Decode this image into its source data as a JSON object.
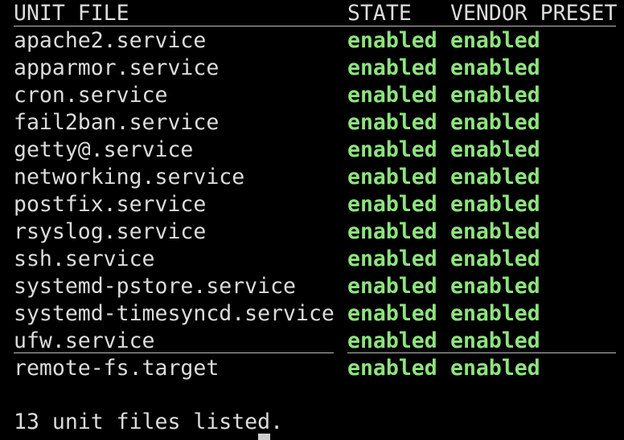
{
  "header": {
    "unit_file": "UNIT FILE",
    "state": "STATE",
    "vendor_preset": "VENDOR PRESET"
  },
  "rows": [
    {
      "unit": "apache2.service",
      "state": "enabled",
      "vendor": "enabled"
    },
    {
      "unit": "apparmor.service",
      "state": "enabled",
      "vendor": "enabled"
    },
    {
      "unit": "cron.service",
      "state": "enabled",
      "vendor": "enabled"
    },
    {
      "unit": "fail2ban.service",
      "state": "enabled",
      "vendor": "enabled"
    },
    {
      "unit": "getty@.service",
      "state": "enabled",
      "vendor": "enabled"
    },
    {
      "unit": "networking.service",
      "state": "enabled",
      "vendor": "enabled"
    },
    {
      "unit": "postfix.service",
      "state": "enabled",
      "vendor": "enabled"
    },
    {
      "unit": "rsyslog.service",
      "state": "enabled",
      "vendor": "enabled"
    },
    {
      "unit": "ssh.service",
      "state": "enabled",
      "vendor": "enabled"
    },
    {
      "unit": "systemd-pstore.service",
      "state": "enabled",
      "vendor": "enabled"
    },
    {
      "unit": "systemd-timesyncd.service",
      "state": "enabled",
      "vendor": "enabled"
    },
    {
      "unit": "ufw.service",
      "state": "enabled",
      "vendor": "enabled"
    },
    {
      "unit": "remote-fs.target",
      "state": "enabled",
      "vendor": "enabled"
    }
  ],
  "footer": {
    "summary": "13 unit files listed."
  },
  "colors": {
    "background": "#000000",
    "text": "#dcdcdc",
    "enabled": "#8ee37e"
  }
}
